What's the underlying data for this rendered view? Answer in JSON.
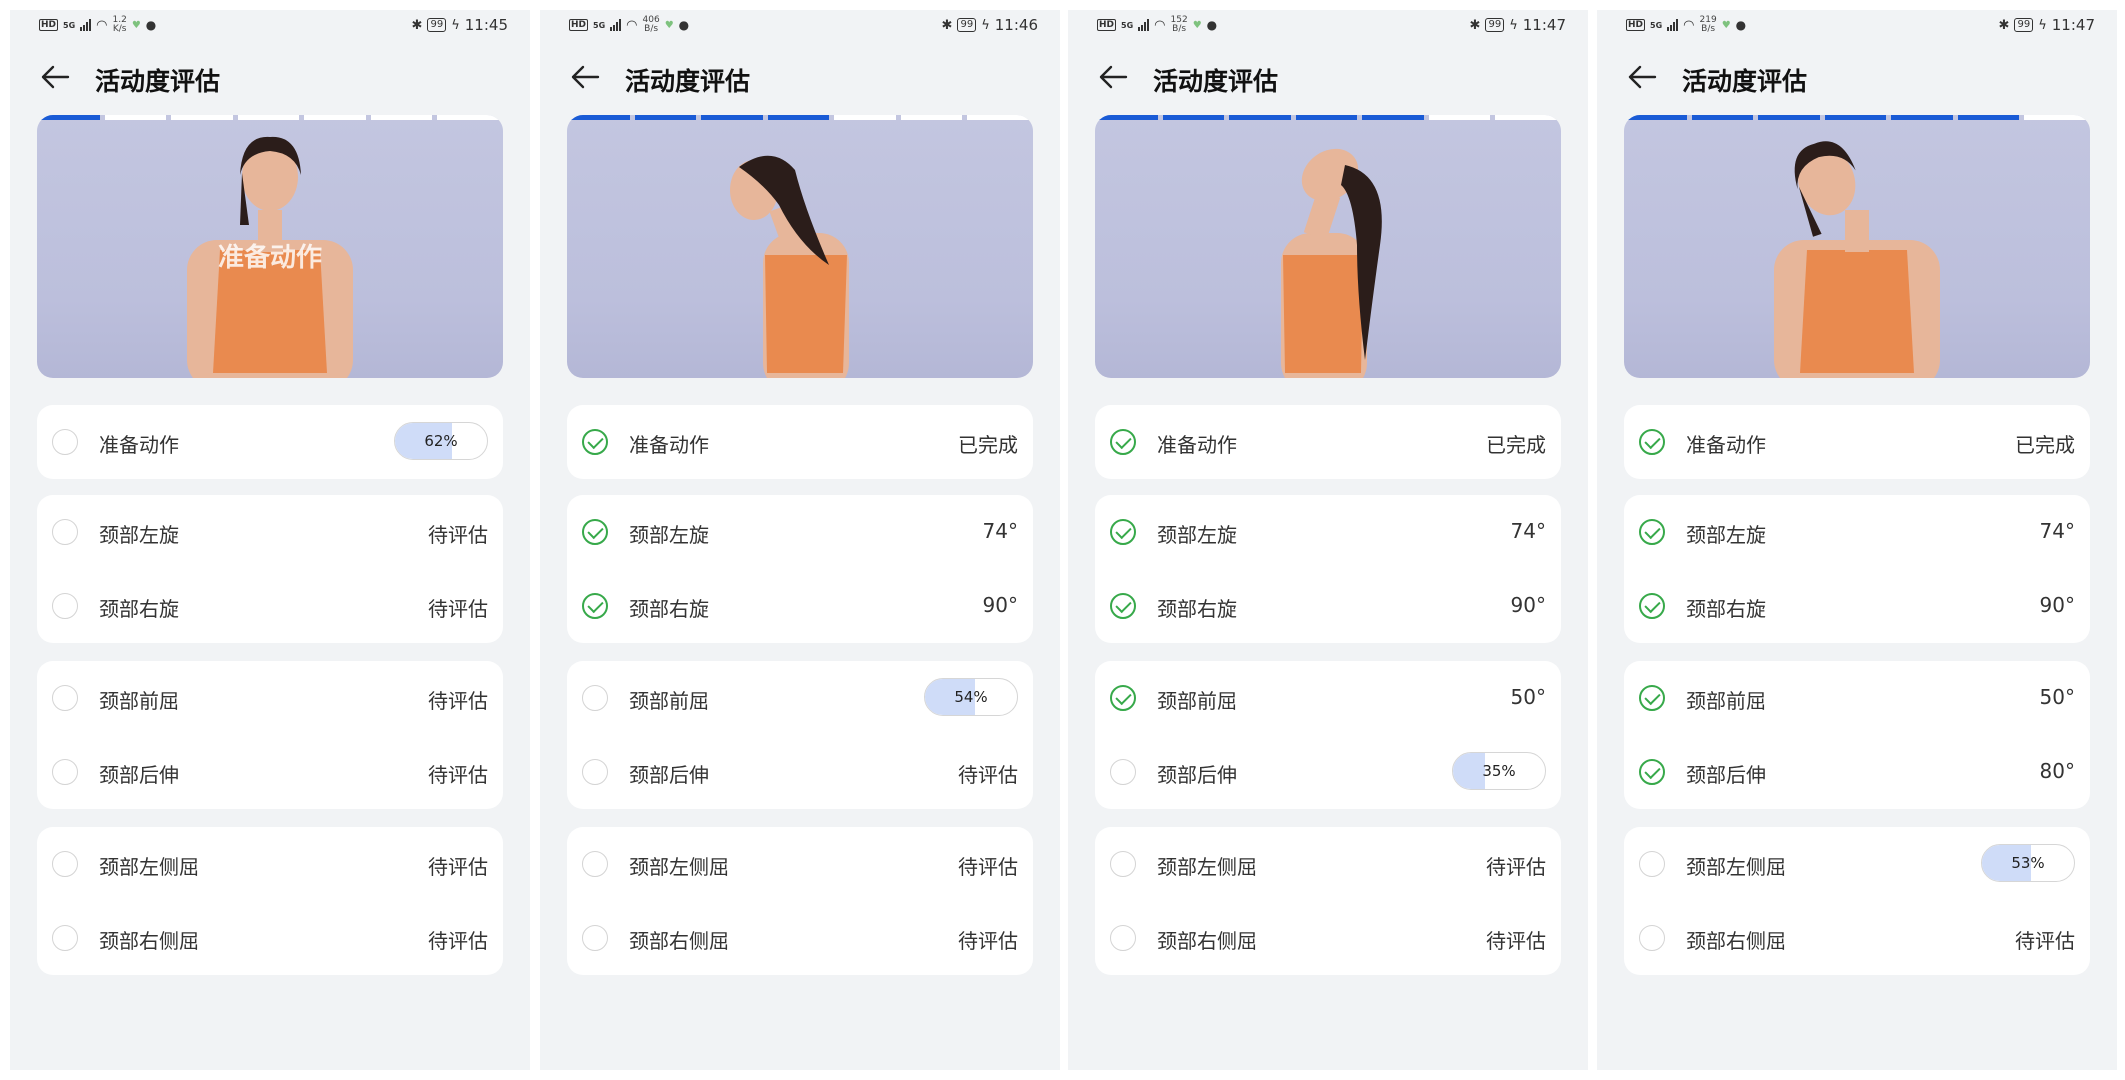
{
  "screens": [
    {
      "status": {
        "speed_top": "1.2",
        "speed_unit": "K/s",
        "battery": "99",
        "time": "11:45"
      },
      "title": "活动度评估",
      "video_overlay": "准备动作",
      "progress_total": 7,
      "progress_done": 1,
      "groups": [
        [
          {
            "label": "准备动作",
            "state": "progress",
            "progress": 0.62,
            "progress_text": "62%"
          }
        ],
        [
          {
            "label": "颈部左旋",
            "state": "pending",
            "value": "待评估"
          },
          {
            "label": "颈部右旋",
            "state": "pending",
            "value": "待评估"
          }
        ],
        [
          {
            "label": "颈部前屈",
            "state": "pending",
            "value": "待评估"
          },
          {
            "label": "颈部后伸",
            "state": "pending",
            "value": "待评估"
          }
        ],
        [
          {
            "label": "颈部左侧屈",
            "state": "pending",
            "value": "待评估"
          },
          {
            "label": "颈部右侧屈",
            "state": "pending",
            "value": "待评估"
          }
        ]
      ]
    },
    {
      "status": {
        "speed_top": "406",
        "speed_unit": "B/s",
        "battery": "99",
        "time": "11:46"
      },
      "title": "活动度评估",
      "video_overlay": "",
      "progress_total": 7,
      "progress_done": 4,
      "groups": [
        [
          {
            "label": "准备动作",
            "state": "done",
            "value": "已完成"
          }
        ],
        [
          {
            "label": "颈部左旋",
            "state": "done",
            "value": "74°"
          },
          {
            "label": "颈部右旋",
            "state": "done",
            "value": "90°"
          }
        ],
        [
          {
            "label": "颈部前屈",
            "state": "progress",
            "progress": 0.54,
            "progress_text": "54%"
          },
          {
            "label": "颈部后伸",
            "state": "pending",
            "value": "待评估"
          }
        ],
        [
          {
            "label": "颈部左侧屈",
            "state": "pending",
            "value": "待评估"
          },
          {
            "label": "颈部右侧屈",
            "state": "pending",
            "value": "待评估"
          }
        ]
      ]
    },
    {
      "status": {
        "speed_top": "152",
        "speed_unit": "B/s",
        "battery": "99",
        "time": "11:47"
      },
      "title": "活动度评估",
      "video_overlay": "",
      "progress_total": 7,
      "progress_done": 5,
      "groups": [
        [
          {
            "label": "准备动作",
            "state": "done",
            "value": "已完成"
          }
        ],
        [
          {
            "label": "颈部左旋",
            "state": "done",
            "value": "74°"
          },
          {
            "label": "颈部右旋",
            "state": "done",
            "value": "90°"
          }
        ],
        [
          {
            "label": "颈部前屈",
            "state": "done",
            "value": "50°"
          },
          {
            "label": "颈部后伸",
            "state": "progress",
            "progress": 0.35,
            "progress_text": "35%"
          }
        ],
        [
          {
            "label": "颈部左侧屈",
            "state": "pending",
            "value": "待评估"
          },
          {
            "label": "颈部右侧屈",
            "state": "pending",
            "value": "待评估"
          }
        ]
      ]
    },
    {
      "status": {
        "speed_top": "219",
        "speed_unit": "B/s",
        "battery": "99",
        "time": "11:47"
      },
      "title": "活动度评估",
      "video_overlay": "",
      "progress_total": 7,
      "progress_done": 6,
      "groups": [
        [
          {
            "label": "准备动作",
            "state": "done",
            "value": "已完成"
          }
        ],
        [
          {
            "label": "颈部左旋",
            "state": "done",
            "value": "74°"
          },
          {
            "label": "颈部右旋",
            "state": "done",
            "value": "90°"
          }
        ],
        [
          {
            "label": "颈部前屈",
            "state": "done",
            "value": "50°"
          },
          {
            "label": "颈部后伸",
            "state": "done",
            "value": "80°"
          }
        ],
        [
          {
            "label": "颈部左侧屈",
            "state": "progress",
            "progress": 0.53,
            "progress_text": "53%"
          },
          {
            "label": "颈部右侧屈",
            "state": "pending",
            "value": "待评估"
          }
        ]
      ]
    }
  ],
  "icons": {
    "back": "arrow-left-icon",
    "check": "check-circle-icon",
    "empty": "empty-circle-icon"
  },
  "colors": {
    "accent": "#1a5bd6",
    "done": "#37a94a",
    "progress_fill": "#cfdcf8",
    "background": "#f1f3f5"
  }
}
